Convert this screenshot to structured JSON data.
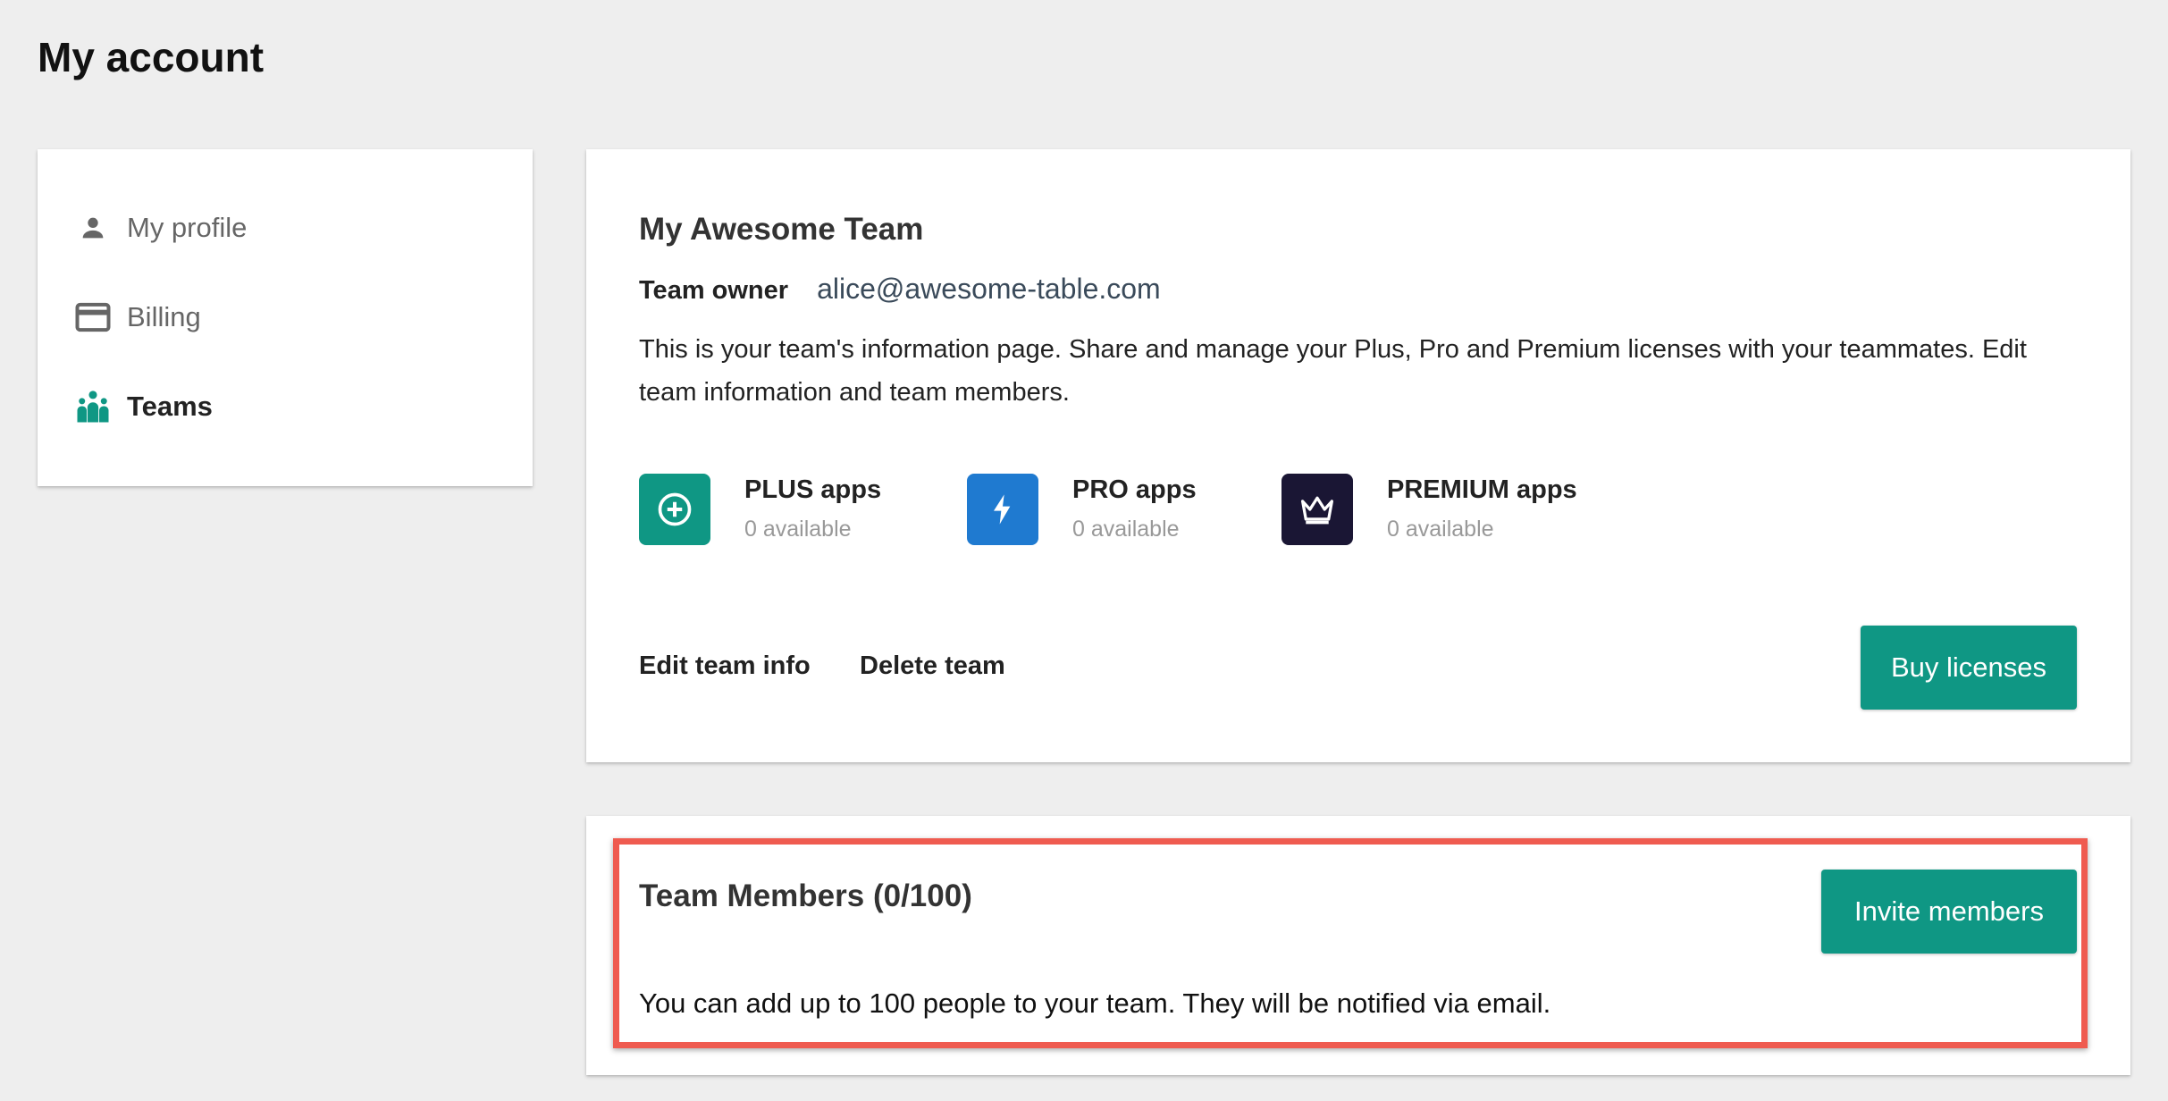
{
  "page": {
    "title": "My account"
  },
  "sidebar": {
    "items": [
      {
        "label": "My profile",
        "icon": "person-icon",
        "active": false
      },
      {
        "label": "Billing",
        "icon": "credit-card-icon",
        "active": false
      },
      {
        "label": "Teams",
        "icon": "people-icon",
        "active": true
      }
    ]
  },
  "team": {
    "name": "My Awesome Team",
    "owner_label": "Team owner",
    "owner_email": "alice@awesome-table.com",
    "description": "This is your team's information page. Share and manage your Plus, Pro and Premium licenses with your teammates. Edit team information and team members.",
    "licenses": [
      {
        "name": "PLUS apps",
        "availability": "0 available",
        "icon": "plus-circle-icon",
        "color": "#0f9784"
      },
      {
        "name": "PRO apps",
        "availability": "0 available",
        "icon": "lightning-icon",
        "color": "#1f7ad0"
      },
      {
        "name": "PREMIUM apps",
        "availability": "0 available",
        "icon": "crown-icon",
        "color": "#1a1634"
      }
    ],
    "actions": {
      "edit_label": "Edit team info",
      "delete_label": "Delete team",
      "buy_label": "Buy licenses"
    }
  },
  "members": {
    "title": "Team Members (0/100)",
    "invite_label": "Invite members",
    "note": "You can add up to 100 people to your team. They will be notified via email."
  },
  "colors": {
    "accent": "#0f9784",
    "highlight": "#ef5b50",
    "background": "#eeeeee"
  }
}
